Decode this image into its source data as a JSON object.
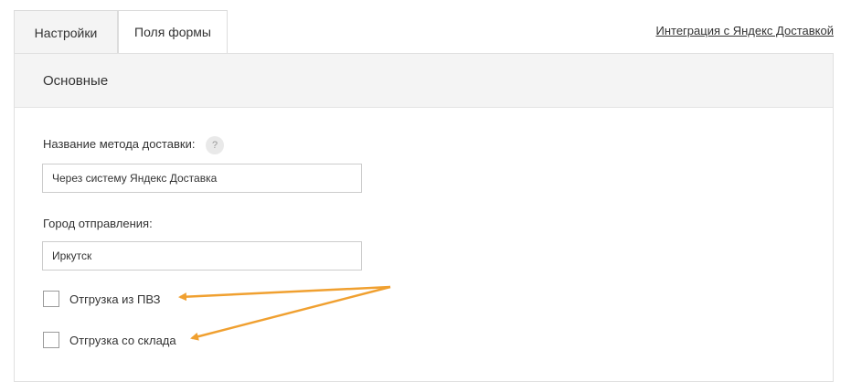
{
  "tabs": [
    {
      "label": "Настройки",
      "active": true
    },
    {
      "label": "Поля формы",
      "active": false
    }
  ],
  "integration_link": "Интеграция с Яндекс Доставкой",
  "section": {
    "title": "Основные"
  },
  "fields": {
    "method_name": {
      "label": "Название метода доставки:",
      "help_icon": "?",
      "value": "Через систему Яндекс Доставка"
    },
    "origin_city": {
      "label": "Город отправления:",
      "value": "Иркутск"
    }
  },
  "checkboxes": [
    {
      "label": "Отгрузка из ПВЗ",
      "checked": false
    },
    {
      "label": "Отгрузка со склада",
      "checked": false
    }
  ],
  "colors": {
    "annotation_arrow": "#f0a030",
    "header_bg": "#f4f4f4"
  }
}
